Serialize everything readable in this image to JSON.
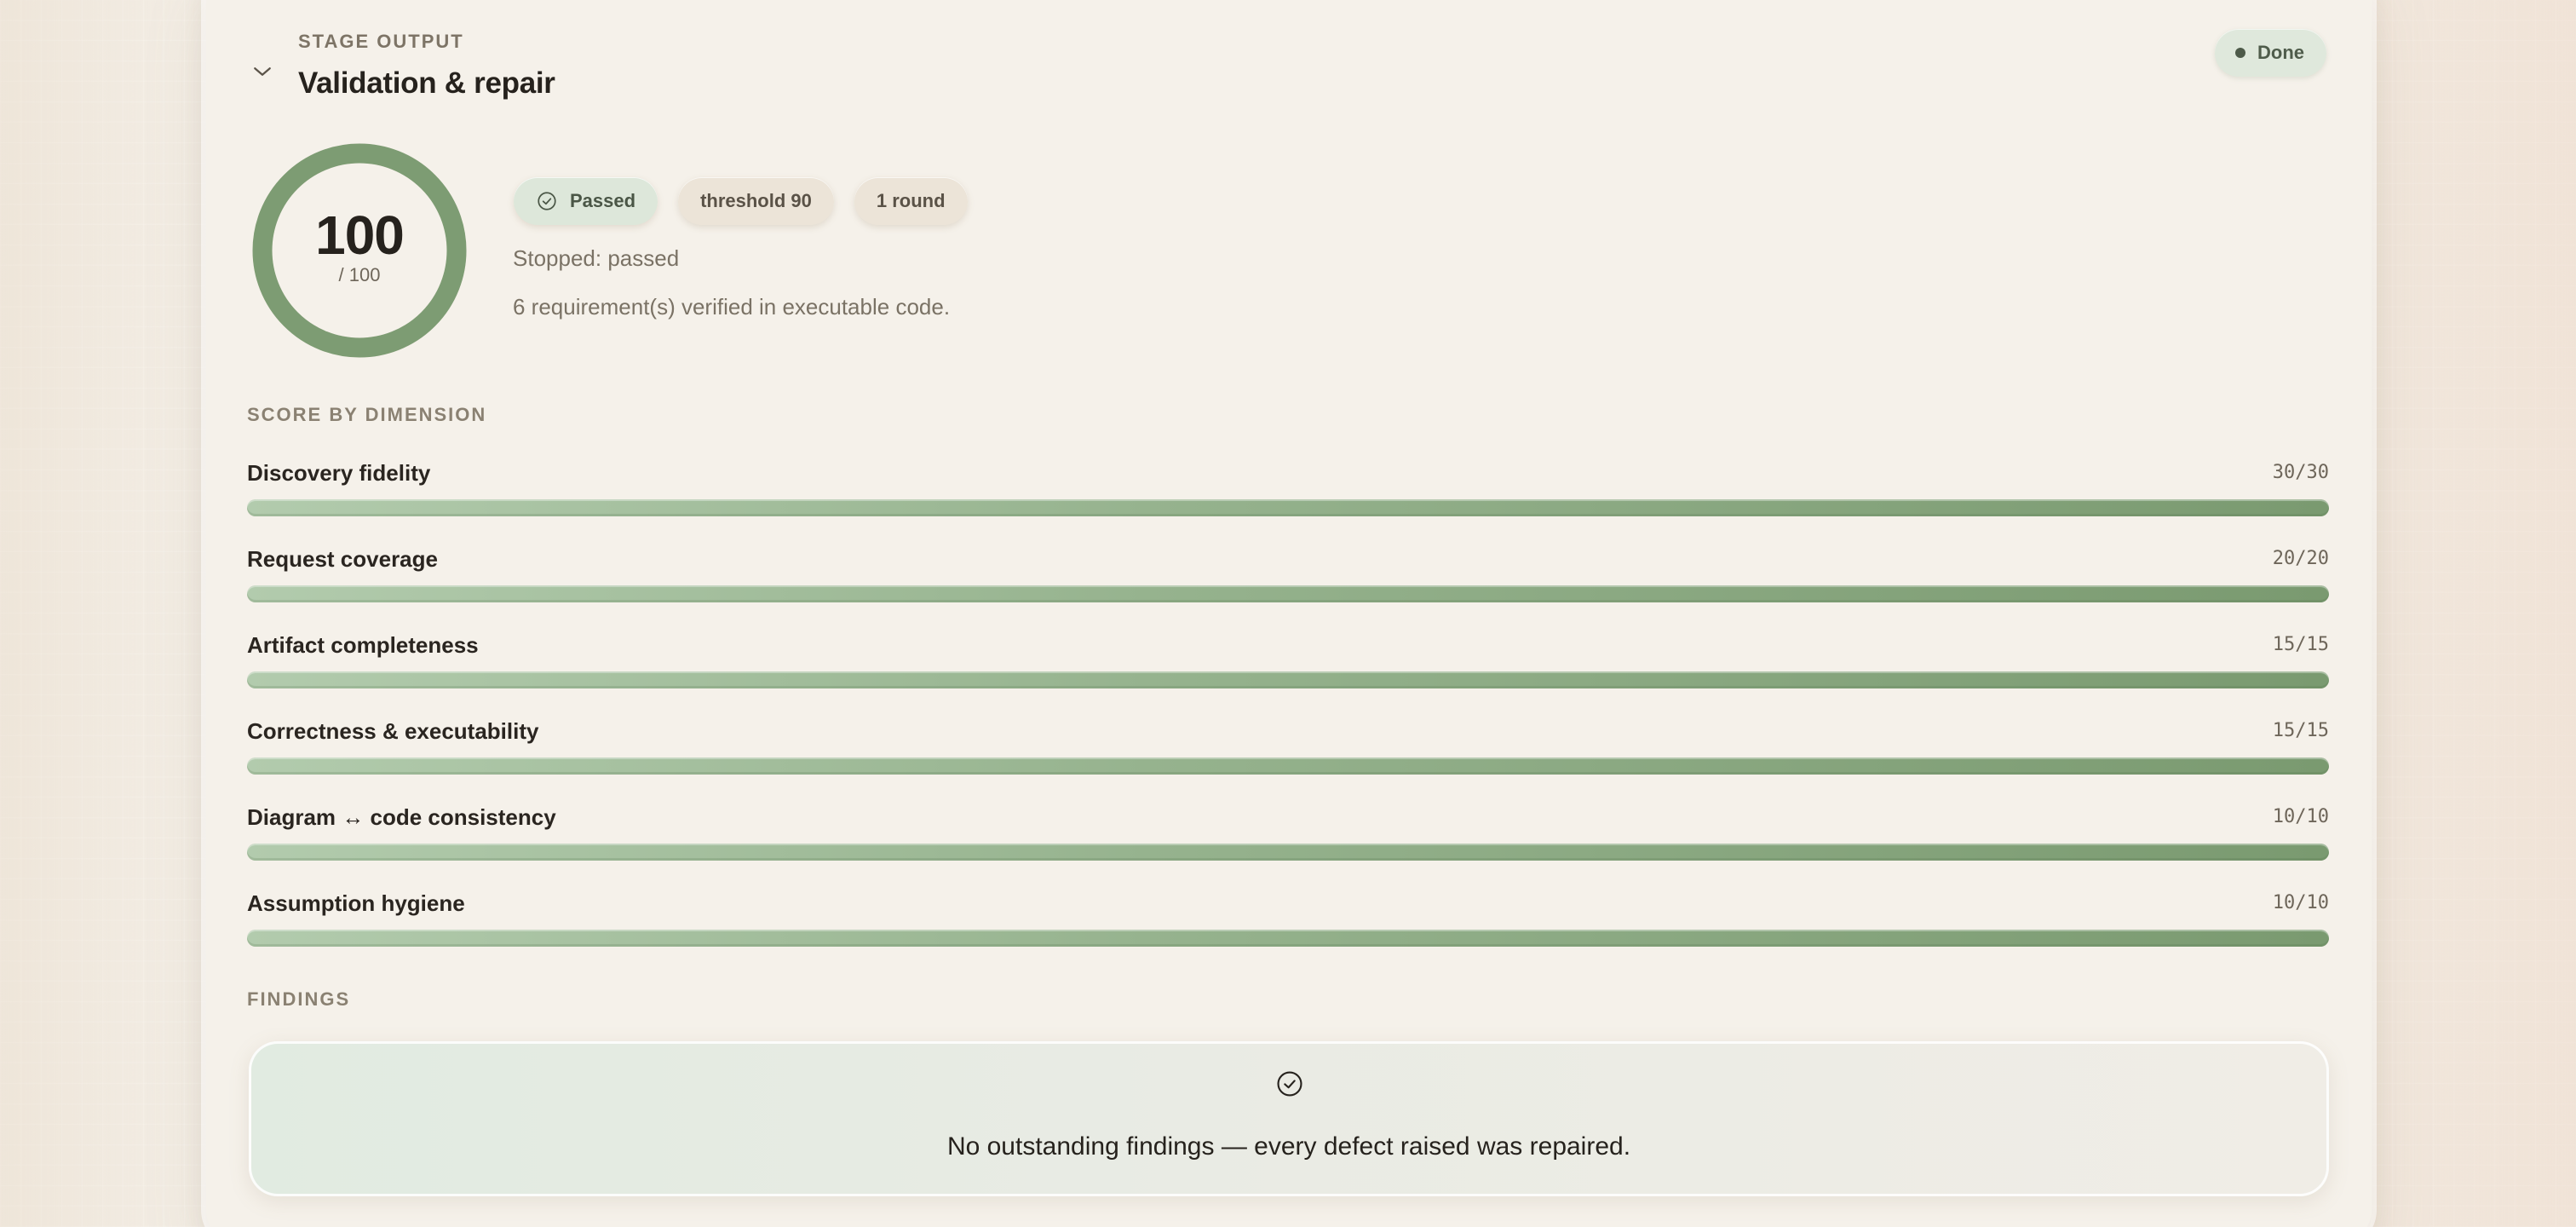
{
  "stage": {
    "kicker": "STAGE OUTPUT",
    "title": "Validation & repair",
    "status": "Done"
  },
  "score": {
    "value": "100",
    "max": "/ 100",
    "fraction": 1.0
  },
  "chips": {
    "passed": "Passed",
    "threshold": "threshold 90",
    "rounds": "1 round"
  },
  "summary": {
    "stopped": "Stopped: passed",
    "verified": "6 requirement(s) verified in executable code."
  },
  "dimensions": {
    "label": "SCORE BY DIMENSION",
    "items": [
      {
        "name": "Discovery fidelity",
        "score": "30/30",
        "fraction": 1.0
      },
      {
        "name": "Request coverage",
        "score": "20/20",
        "fraction": 1.0
      },
      {
        "name": "Artifact completeness",
        "score": "15/15",
        "fraction": 1.0
      },
      {
        "name": "Correctness & executability",
        "score": "15/15",
        "fraction": 1.0
      },
      {
        "name": "Diagram ↔ code consistency",
        "score": "10/10",
        "fraction": 1.0
      },
      {
        "name": "Assumption hygiene",
        "score": "10/10",
        "fraction": 1.0
      }
    ]
  },
  "findings": {
    "label": "FINDINGS",
    "message": "No outstanding findings — every defect raised was repaired."
  },
  "colors": {
    "accent_green": "#7a9a70",
    "badge_green_bg": "#dfe8dc",
    "card_bg": "#f5f1ea"
  },
  "icons": {
    "collapse": "chevron-down-icon",
    "passed": "check-circle-icon",
    "status": "dot-icon",
    "findings": "check-circle-icon"
  }
}
